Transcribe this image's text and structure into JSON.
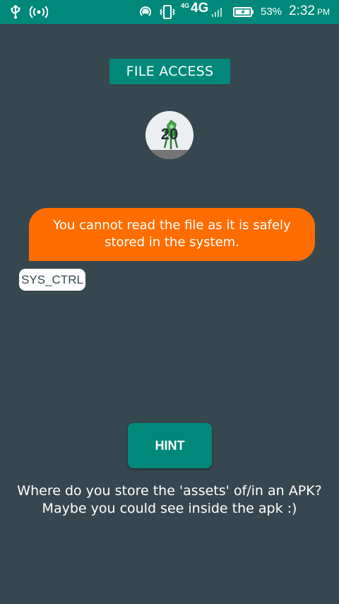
{
  "status_bar": {
    "network_generation_sup": "4G",
    "network_generation": "4G",
    "battery_percent": "53%",
    "time": "2:32",
    "am_pm": "PM",
    "icons": [
      "usb-icon",
      "hotspot-icon",
      "sync-icon",
      "vibrate-icon",
      "signal-icon",
      "battery-charging-icon"
    ],
    "background_color": "#00897b"
  },
  "header": {
    "title": "FILE ACCESS"
  },
  "avatar": {
    "level_number": "20",
    "icon": "rocket-icon"
  },
  "message": {
    "text": "You cannot read the file as it is safely stored in the system.",
    "bubble_color": "#ff6d00"
  },
  "sender": {
    "label": "SYS_CTRL"
  },
  "hint": {
    "button_label": "HINT",
    "text": "Where do you store the 'assets' of/in an APK? Maybe you could see inside the apk :)"
  },
  "colors": {
    "background": "#37474f",
    "accent": "#00897b"
  }
}
